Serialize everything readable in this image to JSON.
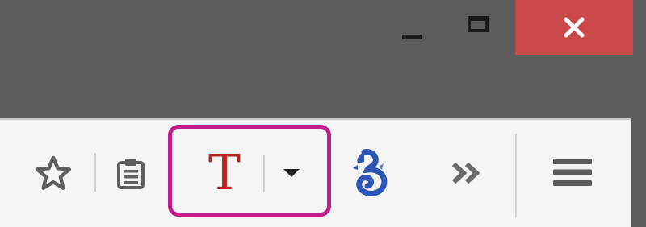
{
  "window": {
    "title_bar_color": "#5c5c5c",
    "close_button_color": "#c9494b",
    "toolbar_color": "#f5f5f5",
    "highlight_color": "#c21d8c"
  },
  "controls": {
    "minimize_icon": "minimize-icon",
    "maximize_icon": "maximize-icon",
    "close_icon": "close-icon"
  },
  "toolbar": {
    "items": [
      {
        "name": "bookmark-star",
        "icon": "star-outline-icon"
      },
      {
        "name": "reading-list",
        "icon": "clipboard-icon"
      },
      {
        "name": "text-tool",
        "icon": "red-serif-t-icon",
        "glyph": "T"
      },
      {
        "name": "text-tool-dropdown",
        "icon": "caret-down-icon"
      },
      {
        "name": "extension",
        "icon": "blue-seahorse-icon"
      },
      {
        "name": "overflow",
        "icon": "double-chevron-right-icon",
        "glyph": "»"
      },
      {
        "name": "menu",
        "icon": "hamburger-icon"
      }
    ]
  }
}
